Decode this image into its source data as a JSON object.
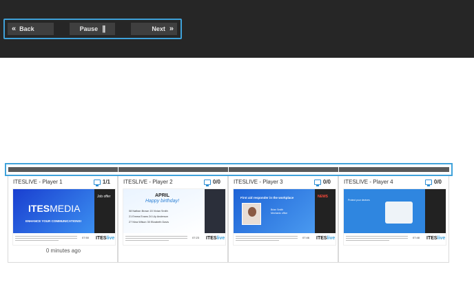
{
  "nav": {
    "back_label": "Back",
    "pause_label": "Pause",
    "next_label": "Next",
    "back_icon": "double-chevron-left-icon",
    "pause_icon": "pause-icon",
    "next_icon": "double-chevron-right-icon"
  },
  "colors": {
    "accent": "#3fa2da",
    "topbar": "#262626",
    "button": "#3f3f3f",
    "strip": "#595959"
  },
  "players": [
    {
      "title": "ITESLIVE - Player 1",
      "count": "1/1",
      "status": "0 minutes ago",
      "preview": {
        "brand_a": "ITES",
        "brand_b": "MEDIA",
        "tagline": "ENHANCE YOUR COMMUNICATIONS!",
        "side": "Job offer",
        "time": "07:50",
        "logo_a": "ITES",
        "logo_b": "live"
      }
    },
    {
      "title": "ITESLIVE - Player 2",
      "count": "0/0",
      "status": "",
      "preview": {
        "heading": "APRIL",
        "subheading": "Happy birthday!",
        "rows": [
          "08 Nathan Brown   15 Vivian Smith",
          "21 Emma Evans   24 Lily Anderson",
          "27 Nina Wilson   30 Elizabeth Davis"
        ],
        "time": "07:23",
        "logo_a": "ITES",
        "logo_b": "live"
      }
    },
    {
      "title": "ITESLIVE - Player 3",
      "count": "0/0",
      "status": "",
      "preview": {
        "heading": "First aid responder in the workplace",
        "news": "NEWS",
        "name": "Brian Smith",
        "role": "Mechanic office",
        "time": "07:46",
        "logo_a": "ITES",
        "logo_b": "live"
      }
    },
    {
      "title": "ITESLIVE - Player 4",
      "count": "0/0",
      "status": "",
      "preview": {
        "heading": "Protect your devices",
        "time": "07:48",
        "logo_a": "ITES",
        "logo_b": "live"
      }
    }
  ]
}
